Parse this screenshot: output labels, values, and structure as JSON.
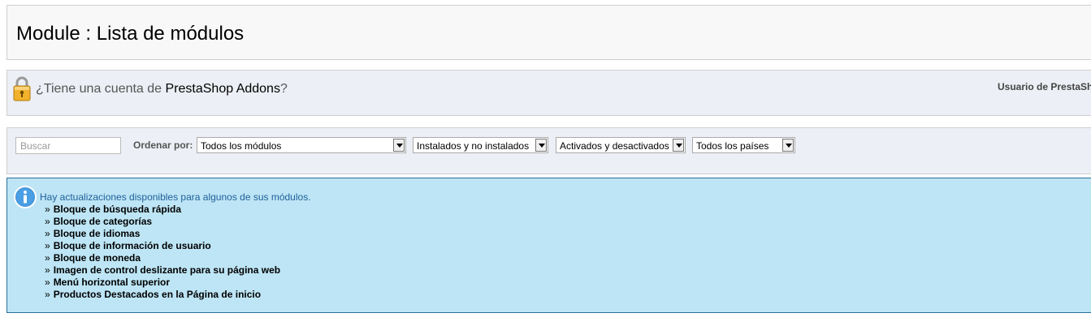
{
  "page": {
    "title": "Module : Lista de módulos"
  },
  "addons": {
    "question_prefix": "¿Tiene una cuenta de ",
    "brand": "PrestaShop Addons",
    "question_suffix": "?",
    "user_label": "Usuario de PrestaSh"
  },
  "filters": {
    "search_placeholder": "Buscar",
    "sort_label": "Ordenar por:",
    "selects": [
      "Todos los módulos",
      "Instalados y no instalados",
      "Activados y desactivados",
      "Todos los países"
    ]
  },
  "updates": {
    "message": "Hay actualizaciones disponibles para algunos de sus módulos.",
    "bullet": "»",
    "modules": [
      "Bloque de búsqueda rápida",
      "Bloque de categorías",
      "Bloque de idiomas",
      "Bloque de información de usuario",
      "Bloque de moneda",
      "Imagen de control deslizante para su página web",
      "Menú horizontal superior",
      "Productos Destacados en la Página de inicio"
    ]
  },
  "icons": {
    "lock": "lock-icon",
    "info": "info-icon",
    "dropdown": "chevron-down-icon"
  },
  "colors": {
    "info_background": "#bde5f5",
    "info_border": "#2a6f9a",
    "info_text": "#1f5f9a",
    "panel_background": "#eceff5"
  }
}
